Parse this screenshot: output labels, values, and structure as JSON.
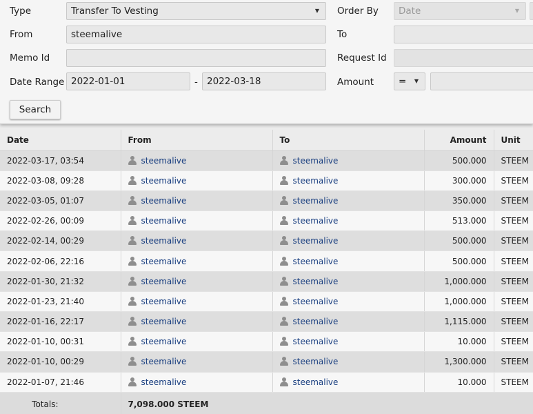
{
  "filters": {
    "type_label": "Type",
    "type_value": "Transfer To Vesting",
    "order_by_label": "Order By",
    "order_by_value": "Date",
    "from_label": "From",
    "from_value": "steemalive",
    "to_label": "To",
    "to_value": "",
    "memo_label": "Memo Id",
    "memo_value": "",
    "request_label": "Request Id",
    "request_value": "",
    "date_range_label": "Date Range",
    "date_start": "2022-01-01",
    "date_separator": "-",
    "date_end": "2022-03-18",
    "amount_label": "Amount",
    "amount_operator": "=",
    "amount_value": "",
    "search_label": "Search"
  },
  "table": {
    "headers": {
      "date": "Date",
      "from": "From",
      "to": "To",
      "amount": "Amount",
      "unit": "Unit"
    },
    "rows": [
      {
        "date": "2022-03-17, 03:54",
        "from": "steemalive",
        "to": "steemalive",
        "amount": "500.000",
        "unit": "STEEM"
      },
      {
        "date": "2022-03-08, 09:28",
        "from": "steemalive",
        "to": "steemalive",
        "amount": "300.000",
        "unit": "STEEM"
      },
      {
        "date": "2022-03-05, 01:07",
        "from": "steemalive",
        "to": "steemalive",
        "amount": "350.000",
        "unit": "STEEM"
      },
      {
        "date": "2022-02-26, 00:09",
        "from": "steemalive",
        "to": "steemalive",
        "amount": "513.000",
        "unit": "STEEM"
      },
      {
        "date": "2022-02-14, 00:29",
        "from": "steemalive",
        "to": "steemalive",
        "amount": "500.000",
        "unit": "STEEM"
      },
      {
        "date": "2022-02-06, 22:16",
        "from": "steemalive",
        "to": "steemalive",
        "amount": "500.000",
        "unit": "STEEM"
      },
      {
        "date": "2022-01-30, 21:32",
        "from": "steemalive",
        "to": "steemalive",
        "amount": "1,000.000",
        "unit": "STEEM"
      },
      {
        "date": "2022-01-23, 21:40",
        "from": "steemalive",
        "to": "steemalive",
        "amount": "1,000.000",
        "unit": "STEEM"
      },
      {
        "date": "2022-01-16, 22:17",
        "from": "steemalive",
        "to": "steemalive",
        "amount": "1,115.000",
        "unit": "STEEM"
      },
      {
        "date": "2022-01-10, 00:31",
        "from": "steemalive",
        "to": "steemalive",
        "amount": "10.000",
        "unit": "STEEM"
      },
      {
        "date": "2022-01-10, 00:29",
        "from": "steemalive",
        "to": "steemalive",
        "amount": "1,300.000",
        "unit": "STEEM"
      },
      {
        "date": "2022-01-07, 21:46",
        "from": "steemalive",
        "to": "steemalive",
        "amount": "10.000",
        "unit": "STEEM"
      }
    ],
    "totals_label": "Totals:",
    "totals_value": "7,098.000 STEEM"
  },
  "icons": {
    "account": "user-icon",
    "dropdown": "caret-down-icon"
  }
}
